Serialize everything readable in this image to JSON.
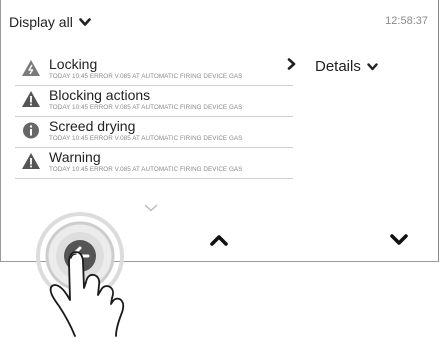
{
  "header": {
    "filter_label": "Display all",
    "time": "12:58:37"
  },
  "messages": [
    {
      "title": "Locking",
      "subtitle": "TODAY 10:45 ERROR V.085 AT AUTOMATIC FIRING DEVICE GAS",
      "icon": "warning-flash-icon"
    },
    {
      "title": "Blocking actions",
      "subtitle": "TODAY 10:45 ERROR V.085 AT AUTOMATIC FIRING DEVICE GAS",
      "icon": "warning-icon"
    },
    {
      "title": "Screed drying",
      "subtitle": "TODAY 10:45 ERROR V.085 AT AUTOMATIC FIRING DEVICE GAS",
      "icon": "info-icon"
    },
    {
      "title": "Warning",
      "subtitle": "TODAY 10:45 ERROR V.085 AT AUTOMATIC FIRING DEVICE GAS",
      "icon": "warning-icon"
    }
  ],
  "details": {
    "label": "Details"
  },
  "nav": {
    "back_icon": "back-arrow-icon",
    "up_icon": "chevron-up-icon",
    "down_icon": "chevron-down-icon"
  },
  "colors": {
    "text": "#222222",
    "muted": "#8a8a8a",
    "divider": "#cfcfcf",
    "icon_gray": "#666666",
    "touch_ring": "#c8c8c8"
  }
}
